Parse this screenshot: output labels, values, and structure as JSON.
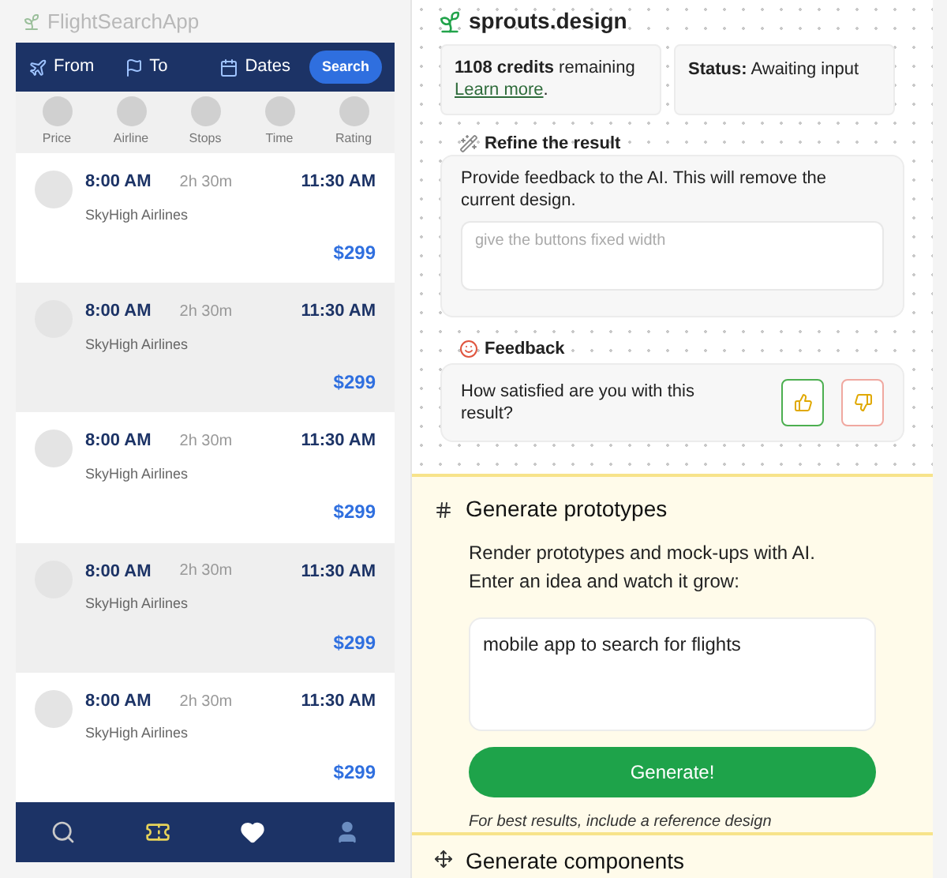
{
  "flight_app": {
    "title": "FlightSearchApp",
    "search_bar": {
      "fields": [
        "From",
        "To",
        "Dates"
      ],
      "button": "Search"
    },
    "filters": [
      "Price",
      "Airline",
      "Stops",
      "Time",
      "Rating"
    ],
    "flights": [
      {
        "depart": "8:00 AM",
        "duration": "2h 30m",
        "arrive": "11:30 AM",
        "airline": "SkyHigh Airlines",
        "price": "$299"
      },
      {
        "depart": "8:00 AM",
        "duration": "2h 30m",
        "arrive": "11:30 AM",
        "airline": "SkyHigh Airlines",
        "price": "$299"
      },
      {
        "depart": "8:00 AM",
        "duration": "2h 30m",
        "arrive": "11:30 AM",
        "airline": "SkyHigh Airlines",
        "price": "$299"
      },
      {
        "depart": "8:00 AM",
        "duration": "2h 30m",
        "arrive": "11:30 AM",
        "airline": "SkyHigh Airlines",
        "price": "$299"
      },
      {
        "depart": "8:00 AM",
        "duration": "2h 30m",
        "arrive": "11:30 AM",
        "airline": "SkyHigh Airlines",
        "price": "$299"
      }
    ],
    "bottom_nav": [
      {
        "kind": "search"
      },
      {
        "kind": "ticket"
      },
      {
        "kind": "heart"
      },
      {
        "kind": "user"
      }
    ]
  },
  "panel": {
    "brand": "sprouts.design",
    "credits": {
      "text": "**1108 credits** remaining",
      "link": "Learn more",
      "after": "."
    },
    "status": {
      "label": "Status:",
      "value": "Awaiting input"
    },
    "refine": {
      "title": "Refine the result",
      "text": "Provide feedback to the AI. This will remove the current design.",
      "placeholder": "give the buttons fixed width"
    },
    "feedback": {
      "title": "Feedback",
      "question": "How satisfied are you with this result?"
    },
    "prototypes": {
      "title": "Generate prototypes",
      "text": "Render prototypes and mock-ups with AI. Enter an idea and watch it grow:",
      "value": "mobile app to search for flights",
      "button": "Generate!",
      "hint": "For best results, include a reference design"
    },
    "components": {
      "title": "Generate components"
    }
  }
}
